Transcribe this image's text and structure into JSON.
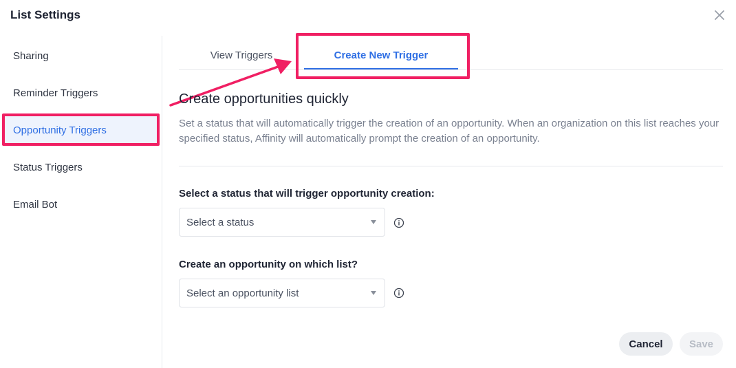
{
  "dialog": {
    "title": "List Settings"
  },
  "sidebar": {
    "items": [
      {
        "label": "Sharing"
      },
      {
        "label": "Reminder Triggers"
      },
      {
        "label": "Opportunity Triggers",
        "active": true
      },
      {
        "label": "Status Triggers"
      },
      {
        "label": "Email Bot"
      }
    ]
  },
  "tabs": [
    {
      "label": "View Triggers"
    },
    {
      "label": "Create New Trigger",
      "active": true
    }
  ],
  "content": {
    "heading": "Create opportunities quickly",
    "description": "Set a status that will automatically trigger the creation of an opportunity. When an organization on this list reaches your specified status, Affinity will automatically prompt the creation of an opportunity.",
    "status_field": {
      "label": "Select a status that will trigger opportunity creation:",
      "placeholder": "Select a status"
    },
    "list_field": {
      "label": "Create an opportunity on which list?",
      "placeholder": "Select an opportunity list"
    }
  },
  "footer": {
    "cancel_label": "Cancel",
    "save_label": "Save"
  },
  "colors": {
    "accent": "#2f6fe4",
    "highlight": "#f01f63"
  },
  "icons": [
    "close-icon",
    "chevron-down-icon",
    "info-icon",
    "annotation-arrow"
  ]
}
